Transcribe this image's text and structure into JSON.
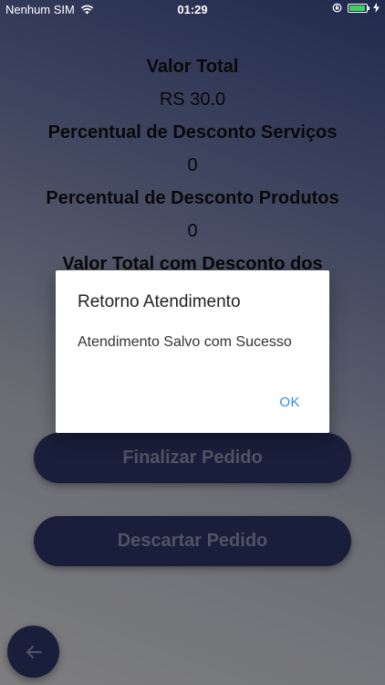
{
  "status_bar": {
    "carrier": "Nenhum SIM",
    "time": "01:29",
    "battery_level": 0.95,
    "battery_color": "#3cd35a"
  },
  "summary": {
    "valor_total_label": "Valor Total",
    "valor_total_value": "RS 30.0",
    "desconto_servicos_label": "Percentual de Desconto Serviços",
    "desconto_servicos_value": "0",
    "desconto_produtos_label": "Percentual de Desconto Produtos",
    "desconto_produtos_value": "0",
    "valor_total_desconto_label": "Valor Total com Desconto dos"
  },
  "buttons": {
    "finalizar": "Finalizar Pedido",
    "descartar": "Descartar Pedido",
    "back_icon": "arrow-left-icon"
  },
  "dialog": {
    "title": "Retorno Atendimento",
    "message": "Atendimento Salvo com Sucesso",
    "ok_label": "OK"
  },
  "colors": {
    "primary": "#2c3565",
    "accent": "#2b8fe8"
  }
}
